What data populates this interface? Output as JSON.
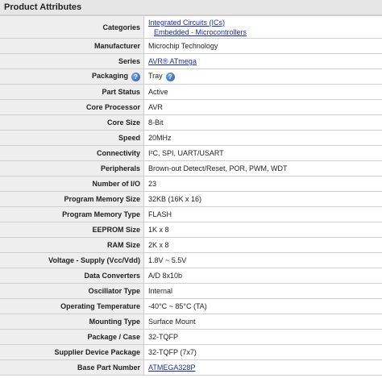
{
  "section": {
    "title": "Product Attributes"
  },
  "rows": [
    {
      "label": "Categories",
      "values": [
        "Integrated Circuits (ICs)",
        "Embedded - Microcontrollers"
      ],
      "links": true
    },
    {
      "label": "Manufacturer",
      "value": "Microchip Technology"
    },
    {
      "label": "Series",
      "value": "AVR® ATmega",
      "link": true
    },
    {
      "label": "Packaging",
      "value": "Tray",
      "help_label": true,
      "help_value": true
    },
    {
      "label": "Part Status",
      "value": "Active"
    },
    {
      "label": "Core Processor",
      "value": "AVR"
    },
    {
      "label": "Core Size",
      "value": "8-Bit"
    },
    {
      "label": "Speed",
      "value": "20MHz"
    },
    {
      "label": "Connectivity",
      "value": "I²C, SPI, UART/USART"
    },
    {
      "label": "Peripherals",
      "value": "Brown-out Detect/Reset, POR, PWM, WDT"
    },
    {
      "label": "Number of I/O",
      "value": "23"
    },
    {
      "label": "Program Memory Size",
      "value": "32KB (16K x 16)"
    },
    {
      "label": "Program Memory Type",
      "value": "FLASH"
    },
    {
      "label": "EEPROM Size",
      "value": "1K x 8"
    },
    {
      "label": "RAM Size",
      "value": "2K x 8"
    },
    {
      "label": "Voltage - Supply (Vcc/Vdd)",
      "value": "1.8V ~ 5.5V"
    },
    {
      "label": "Data Converters",
      "value": "A/D 8x10b"
    },
    {
      "label": "Oscillator Type",
      "value": "Internal"
    },
    {
      "label": "Operating Temperature",
      "value": "-40°C ~ 85°C (TA)"
    },
    {
      "label": "Mounting Type",
      "value": "Surface Mount"
    },
    {
      "label": "Package / Case",
      "value": "32-TQFP"
    },
    {
      "label": "Supplier Device Package",
      "value": "32-TQFP (7x7)"
    },
    {
      "label": "Base Part Number",
      "value": "ATMEGA328P",
      "link": true
    }
  ],
  "icons": {
    "help": "help-icon"
  },
  "help_glyph": "?"
}
